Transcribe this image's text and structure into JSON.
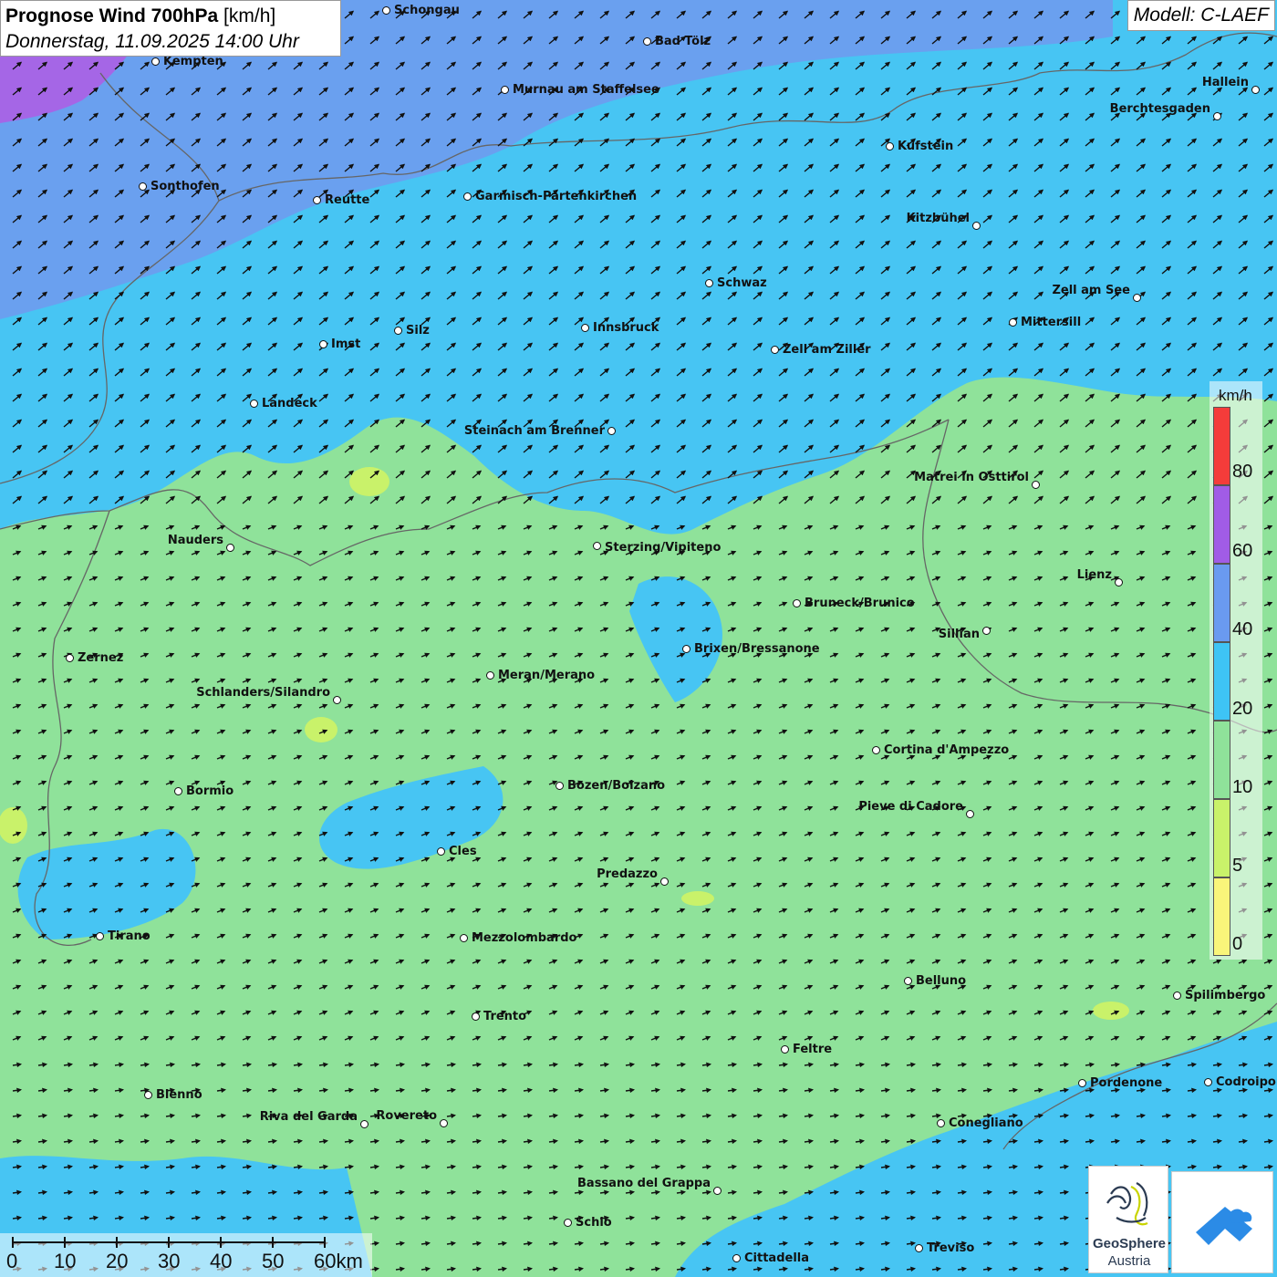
{
  "title": {
    "bold": "Prognose Wind 700hPa",
    "unit": "[km/h]",
    "datetime": "Donnerstag, 11.09.2025 14:00 Uhr"
  },
  "model": "Modell: C-LAEF",
  "legend": {
    "unit": "km/h",
    "labels": [
      "80",
      "60",
      "40",
      "20",
      "10",
      "5",
      "0"
    ],
    "colors": [
      "#f43c3a",
      "#a15ce6",
      "#6a9af0",
      "#3ec4f5",
      "#8fe29a",
      "#c9f26a",
      "#f9f57a"
    ]
  },
  "scale_bar": {
    "labels": [
      "0",
      "10",
      "20",
      "30",
      "40",
      "50",
      "60km"
    ]
  },
  "logo": {
    "name": "GeoSphere",
    "sub": "Austria"
  },
  "cities": [
    {
      "name": "Schongau"
    },
    {
      "name": "Bad Tölz"
    },
    {
      "name": "Kempten"
    },
    {
      "name": "Murnau am Staffelsee"
    },
    {
      "name": "Hallein"
    },
    {
      "name": "Berchtesgaden"
    },
    {
      "name": "Kufstein"
    },
    {
      "name": "Sonthofen"
    },
    {
      "name": "Reutte"
    },
    {
      "name": "Garmisch-Partenkirchen"
    },
    {
      "name": "Kitzbühel"
    },
    {
      "name": "Schwaz"
    },
    {
      "name": "Zell am See"
    },
    {
      "name": "Mittersill"
    },
    {
      "name": "Innsbruck"
    },
    {
      "name": "Silz"
    },
    {
      "name": "Imst"
    },
    {
      "name": "Zell am Ziller"
    },
    {
      "name": "Landeck"
    },
    {
      "name": "Steinach am Brenner"
    },
    {
      "name": "Matrei in Osttirol"
    },
    {
      "name": "Nauders"
    },
    {
      "name": "Sterzing/Vipiteno"
    },
    {
      "name": "Lienz"
    },
    {
      "name": "Bruneck/Brunico"
    },
    {
      "name": "Sillian"
    },
    {
      "name": "Brixen/Bressanone"
    },
    {
      "name": "Zernez"
    },
    {
      "name": "Meran/Merano"
    },
    {
      "name": "Schlanders/Silandro"
    },
    {
      "name": "Cortina d'Ampezzo"
    },
    {
      "name": "Bozen/Bolzano"
    },
    {
      "name": "Bormio"
    },
    {
      "name": "Pieve di Cadore"
    },
    {
      "name": "Cles"
    },
    {
      "name": "Predazzo"
    },
    {
      "name": "Tirano"
    },
    {
      "name": "Mezzolombardo"
    },
    {
      "name": "Belluno"
    },
    {
      "name": "Spilimbergo"
    },
    {
      "name": "Trento"
    },
    {
      "name": "Feltre"
    },
    {
      "name": "Pordenone"
    },
    {
      "name": "Codroipo"
    },
    {
      "name": "Bienno"
    },
    {
      "name": "Riva del Garda"
    },
    {
      "name": "Rovereto"
    },
    {
      "name": "Conegliano"
    },
    {
      "name": "Bassano del Grappa"
    },
    {
      "name": "Schio"
    },
    {
      "name": "Treviso"
    },
    {
      "name": "Cittadella"
    }
  ]
}
